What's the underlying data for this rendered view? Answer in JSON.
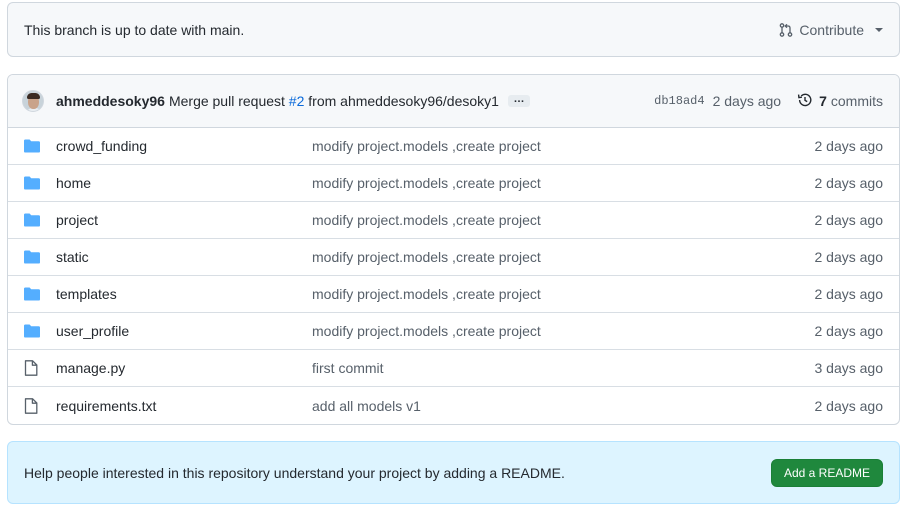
{
  "branch_status": {
    "text": "This branch is up to date with main.",
    "contribute_label": "Contribute"
  },
  "latest_commit": {
    "author": "ahmeddesoky96",
    "message_prefix": "Merge pull request",
    "pr_link": "#2",
    "message_suffix": "from ahmeddesoky96/desoky1",
    "ellipsis": "…",
    "sha": "db18ad4",
    "age": "2 days ago",
    "commit_count": "7",
    "commits_label": "commits"
  },
  "files": [
    {
      "name": "crowd_funding",
      "type": "folder",
      "commit": "modify project.models ,create project",
      "age": "2 days ago"
    },
    {
      "name": "home",
      "type": "folder",
      "commit": "modify project.models ,create project",
      "age": "2 days ago"
    },
    {
      "name": "project",
      "type": "folder",
      "commit": "modify project.models ,create project",
      "age": "2 days ago"
    },
    {
      "name": "static",
      "type": "folder",
      "commit": "modify project.models ,create project",
      "age": "2 days ago"
    },
    {
      "name": "templates",
      "type": "folder",
      "commit": "modify project.models ,create project",
      "age": "2 days ago"
    },
    {
      "name": "user_profile",
      "type": "folder",
      "commit": "modify project.models ,create project",
      "age": "2 days ago"
    },
    {
      "name": "manage.py",
      "type": "file",
      "commit": "first commit",
      "age": "3 days ago"
    },
    {
      "name": "requirements.txt",
      "type": "file",
      "commit": "add all models v1",
      "age": "2 days ago"
    }
  ],
  "readme_prompt": {
    "text": "Help people interested in this repository understand your project by adding a README.",
    "button_label": "Add a README"
  },
  "colors": {
    "folder": "#54aeff",
    "link": "#0969da",
    "button_green": "#1f883d"
  },
  "icons": {
    "contribute": "git-pull-request-icon",
    "history": "history-icon",
    "folder": "folder-icon",
    "file": "file-icon"
  }
}
